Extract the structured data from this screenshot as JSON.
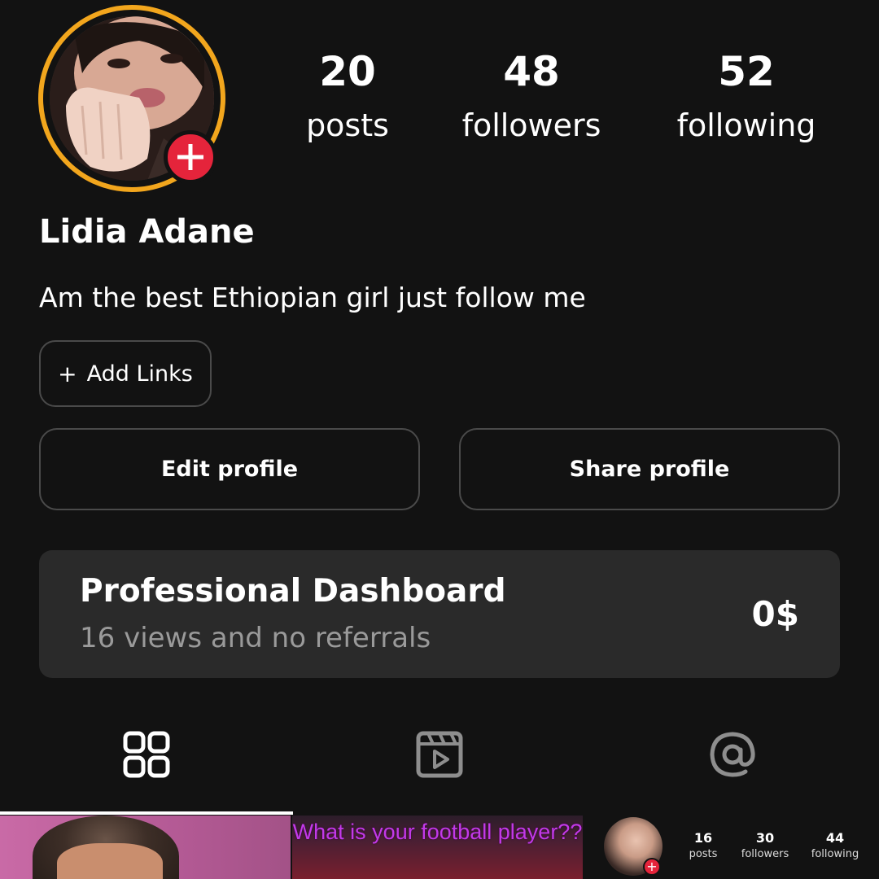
{
  "profile": {
    "name": "Lidia Adane",
    "bio": "Am the best Ethiopian girl just follow me"
  },
  "stats": {
    "posts": {
      "value": "20",
      "label": "posts"
    },
    "followers": {
      "value": "48",
      "label": "followers"
    },
    "following": {
      "value": "52",
      "label": "following"
    }
  },
  "actions": {
    "add_links_icon": "+",
    "add_links_label": "Add Links",
    "edit_profile_label": "Edit profile",
    "share_profile_label": "Share profile"
  },
  "dashboard": {
    "title": "Professional Dashboard",
    "subtitle": "16 views and no referrals",
    "amount": "0$"
  },
  "tabs": [
    {
      "icon": "grid-icon",
      "active": true
    },
    {
      "icon": "reels-icon",
      "active": false
    },
    {
      "icon": "tagged-icon",
      "active": false
    }
  ],
  "posts": {
    "post_2_caption": "What is your football player??",
    "post_3": {
      "add_icon": "+",
      "posts_value": "16",
      "posts_label": "posts",
      "followers_value": "30",
      "followers_label": "followers",
      "following_value": "44",
      "following_label": "following"
    }
  },
  "colors": {
    "background": "#121212",
    "story_ring": "#f2a61d",
    "add_badge": "#e5243b",
    "card": "#2a2a2a",
    "muted_text": "#9a9a9a",
    "border": "#4a4a4a"
  }
}
